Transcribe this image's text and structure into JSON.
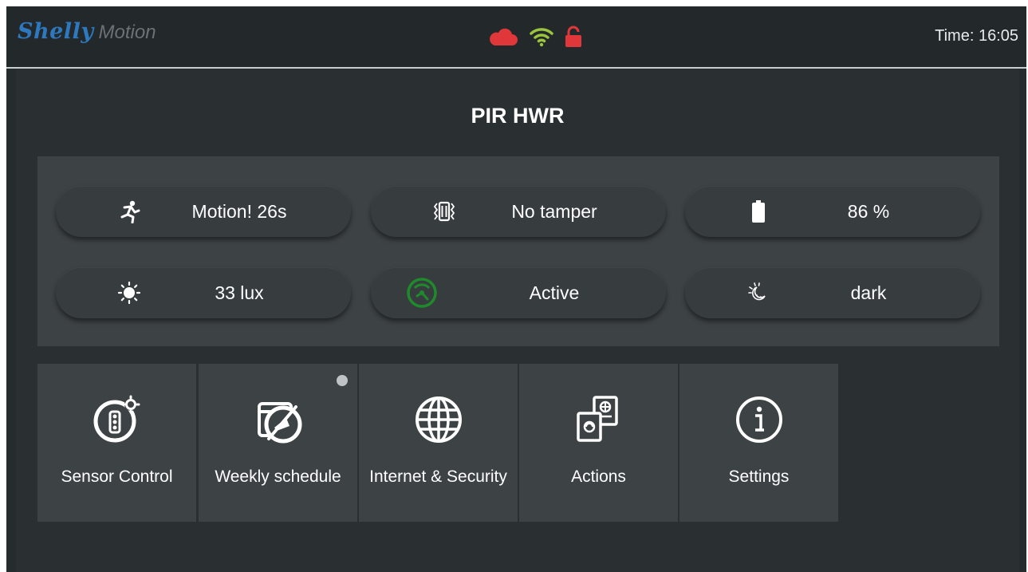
{
  "header": {
    "brand": "Shelly",
    "product": "Motion",
    "status_icons": [
      "cloud-icon",
      "wifi-icon",
      "unlocked-icon"
    ],
    "time_label": "Time: 16:05"
  },
  "page": {
    "title": "PIR HWR"
  },
  "status": [
    {
      "icon": "running-person-icon",
      "label": "Motion! 26s"
    },
    {
      "icon": "tamper-icon",
      "label": "No tamper"
    },
    {
      "icon": "battery-icon",
      "label": "86 %"
    },
    {
      "icon": "sun-icon",
      "label": "33 lux"
    },
    {
      "icon": "sensor-active-icon",
      "label": "Active"
    },
    {
      "icon": "dark-mode-icon",
      "label": "dark"
    }
  ],
  "tiles": [
    {
      "icon": "sensor-control-icon",
      "label": "Sensor Control"
    },
    {
      "icon": "weekly-schedule-icon",
      "label": "Weekly schedule",
      "has_indicator": true
    },
    {
      "icon": "globe-icon",
      "label": "Internet & Security"
    },
    {
      "icon": "actions-icon",
      "label": "Actions"
    },
    {
      "icon": "info-icon",
      "label": "Settings"
    }
  ],
  "colors": {
    "brand_blue": "#2e78bf",
    "cloud_red": "#e0383a",
    "wifi_green": "#9bc53d",
    "lock_red": "#e0383a",
    "active_green": "#1f8a2c",
    "background": "#2a2f32",
    "panel": "#3d4245"
  }
}
